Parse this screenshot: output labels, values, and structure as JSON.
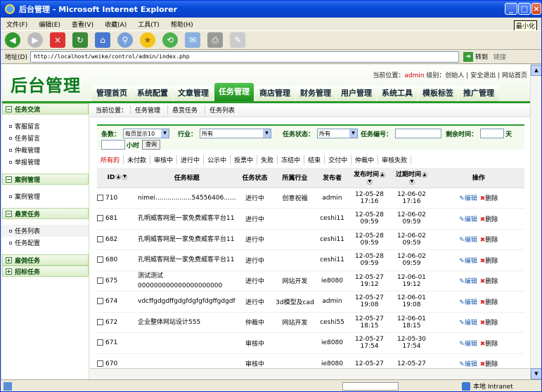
{
  "window": {
    "title": "后台管理 - Microsoft Internet Explorer",
    "max_tip": "最小化"
  },
  "menu": [
    "文件(F)",
    "编辑(E)",
    "查看(V)",
    "收藏(A)",
    "工具(T)",
    "帮助(H)"
  ],
  "address": {
    "label": "地址(D)",
    "url": "http://localhost/weike/control/admin/index.php",
    "go": "转到",
    "links": "链接"
  },
  "header": {
    "logo": "后台管理",
    "location_label": "当前位置：",
    "user": "admin",
    "level": "级别：创始人",
    "logout": "安全退出",
    "home": "网站首页"
  },
  "nav": [
    "管理首页",
    "系统配置",
    "文章管理",
    "任务管理",
    "商店管理",
    "财务管理",
    "用户管理",
    "系统工具",
    "模板标签",
    "推广管理"
  ],
  "nav_active": 3,
  "sidebar": [
    {
      "title": "任务交流",
      "open": true,
      "items": [
        "客服留言",
        "任务留言",
        "仲裁管理",
        "举报管理"
      ]
    },
    {
      "title": "案例管理",
      "open": true,
      "items": [
        "案例管理"
      ]
    },
    {
      "title": "悬赏任务",
      "open": true,
      "items": [
        "任务列表",
        "任务配置"
      ]
    },
    {
      "title": "雇佣任务",
      "open": false,
      "items": []
    },
    {
      "title": "招标任务",
      "open": false,
      "items": []
    }
  ],
  "crumbs": {
    "label": "当前位置：",
    "items": [
      "任务管理",
      "悬赏任务",
      "任务列表"
    ]
  },
  "filter": {
    "count_label": "条数：",
    "count_value": "每页显示10",
    "industry_label": "行业：",
    "industry_value": "所有",
    "status_label": "任务状态：",
    "status_value": "所有",
    "id_label": "任务编号：",
    "remain_label": "剩余时间：",
    "day": "天",
    "hour": "小时",
    "search": "查询"
  },
  "status_tabs": [
    "所有的",
    "未付款",
    "审核中",
    "进行中",
    "公示中",
    "投票中",
    "失败",
    "冻结中",
    "结束",
    "交付中",
    "仲裁中",
    "审核失败"
  ],
  "table": {
    "headers": [
      "ID",
      "任务标题",
      "任务状态",
      "所属行业",
      "发布者",
      "发布时间",
      "过期时间",
      "操作"
    ],
    "edit": "编辑",
    "del": "删除",
    "rows": [
      {
        "id": "710",
        "title": "nimei..................54556406......",
        "status": "进行中",
        "industry": "创意祝福",
        "user": "admin",
        "pub_d": "12-05-28",
        "pub_t": "17:16",
        "exp_d": "12-06-02",
        "exp_t": "17:16"
      },
      {
        "id": "681",
        "title": "孔明威客网是一家免费威客平台11",
        "status": "进行中",
        "industry": "",
        "user": "ceshi11",
        "pub_d": "12-05-28",
        "pub_t": "09:59",
        "exp_d": "12-06-02",
        "exp_t": "09:59"
      },
      {
        "id": "682",
        "title": "孔明威客网是一家免费威客平台11",
        "status": "进行中",
        "industry": "",
        "user": "ceshi11",
        "pub_d": "12-05-28",
        "pub_t": "09:59",
        "exp_d": "12-06-02",
        "exp_t": "09:59"
      },
      {
        "id": "680",
        "title": "孔明威客网是一家免费威客平台11",
        "status": "进行中",
        "industry": "",
        "user": "ceshi11",
        "pub_d": "12-05-28",
        "pub_t": "09:59",
        "exp_d": "12-06-02",
        "exp_t": "09:59"
      },
      {
        "id": "675",
        "title": "测试测试000000000000000000000",
        "status": "进行中",
        "industry": "网站开发",
        "user": "ie8080",
        "pub_d": "12-05-27",
        "pub_t": "19:12",
        "exp_d": "12-06-01",
        "exp_t": "19:12"
      },
      {
        "id": "674",
        "title": "vdcffgdgdffgdgfdgfgfdgffgdgdf",
        "status": "进行中",
        "industry": "3d模型及cad",
        "user": "admin",
        "pub_d": "12-05-27",
        "pub_t": "19:08",
        "exp_d": "12-06-01",
        "exp_t": "19:08"
      },
      {
        "id": "672",
        "title": "企业整体网站设计555",
        "status": "仲裁中",
        "industry": "网站开发",
        "user": "ceshi55",
        "pub_d": "12-05-27",
        "pub_t": "18:15",
        "exp_d": "12-06-01",
        "exp_t": "18:15"
      },
      {
        "id": "671",
        "title": "",
        "status": "审核中",
        "industry": "",
        "user": "ie8080",
        "pub_d": "12-05-27",
        "pub_t": "17:54",
        "exp_d": "12-05-30",
        "exp_t": "17:54"
      },
      {
        "id": "670",
        "title": "",
        "status": "审核中",
        "industry": "",
        "user": "ie8080",
        "pub_d": "12-05-27",
        "pub_t": "",
        "exp_d": "12-05-27",
        "exp_t": ""
      }
    ]
  },
  "status": {
    "zone": "本地 Intranet"
  }
}
